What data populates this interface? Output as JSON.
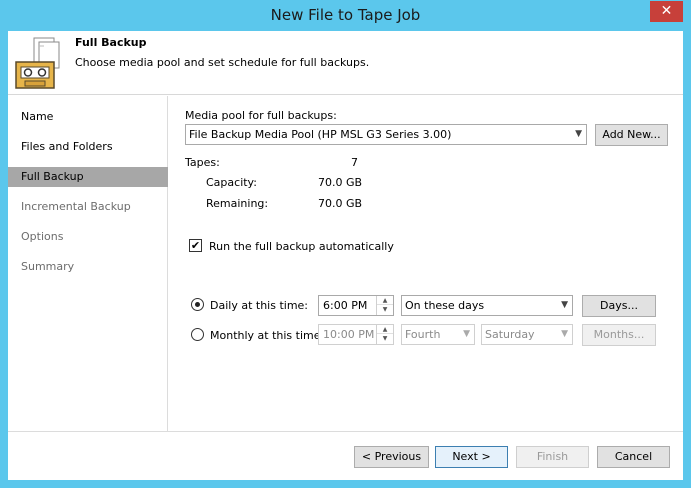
{
  "window": {
    "title": "New File to Tape Job",
    "close_glyph": "✕"
  },
  "header": {
    "title": "Full Backup",
    "description": "Choose media pool and set schedule for full backups.",
    "icon": "tape-job-icon"
  },
  "sidebar": {
    "items": [
      {
        "label": "Name",
        "state": "normal"
      },
      {
        "label": "Files and Folders",
        "state": "normal"
      },
      {
        "label": "Full Backup",
        "state": "active"
      },
      {
        "label": "Incremental Backup",
        "state": "disabled"
      },
      {
        "label": "Options",
        "state": "disabled"
      },
      {
        "label": "Summary",
        "state": "disabled"
      }
    ]
  },
  "media_pool": {
    "label": "Media pool for full backups:",
    "value": "File Backup Media Pool (HP MSL G3 Series 3.00)",
    "add_button": "Add New..."
  },
  "tapes": {
    "label": "Tapes:",
    "count": "7",
    "capacity_label": "Capacity:",
    "capacity_value": "70.0 GB",
    "remaining_label": "Remaining:",
    "remaining_value": "70.0 GB"
  },
  "schedule": {
    "auto_label": "Run the full backup automatically",
    "auto_checked": true,
    "daily": {
      "label": "Daily at this time:",
      "selected": true,
      "time": "6:00 PM",
      "days_option": "On these days",
      "days_button": "Days..."
    },
    "monthly": {
      "label": "Monthly at this time:",
      "selected": false,
      "time": "10:00 PM",
      "week": "Fourth",
      "weekday": "Saturday",
      "months_button": "Months..."
    }
  },
  "footer": {
    "previous": "< Previous",
    "next": "Next >",
    "finish": "Finish",
    "cancel": "Cancel"
  },
  "colors": {
    "title_bar": "#5bc7ec",
    "close_button": "#c7403a",
    "active_nav": "#a7a7a7"
  }
}
